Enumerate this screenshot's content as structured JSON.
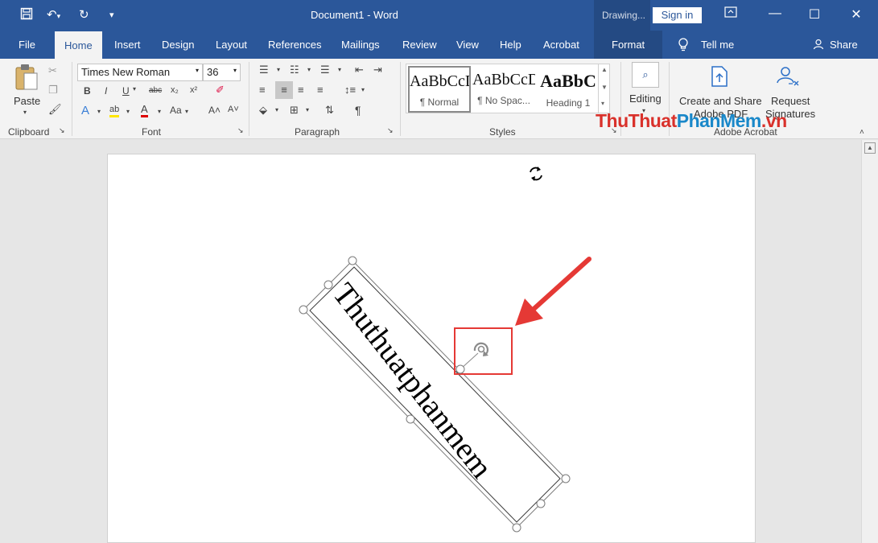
{
  "titlebar": {
    "title": "Document1  -  Word",
    "drawing_label": "Drawing...",
    "sign_in": "Sign in"
  },
  "tabs": [
    "File",
    "Home",
    "Insert",
    "Design",
    "Layout",
    "References",
    "Mailings",
    "Review",
    "View",
    "Help",
    "Acrobat",
    "Format"
  ],
  "tell_me": "Tell me",
  "share": "Share",
  "ribbon": {
    "paste": "Paste",
    "clipboard": "Clipboard",
    "font_name": "Times New Roman",
    "font_size": "36",
    "font_group": "Font",
    "paragraph_group": "Paragraph",
    "styles_group": "Styles",
    "styles": [
      {
        "sample": "AaBbCcDc",
        "name": "¶ Normal"
      },
      {
        "sample": "AaBbCcDc",
        "name": "¶ No Spac..."
      },
      {
        "sample": "AaBbC",
        "name": "Heading 1"
      }
    ],
    "editing": "Editing",
    "create_share_1": "Create and Share",
    "create_share_2": "Adobe PDF",
    "request_1": "Request",
    "request_2": "Signatures",
    "adobe_group": "Adobe Acrobat"
  },
  "watermark": {
    "a": "ThuThuat",
    "b": "PhanMem",
    "c": ".vn"
  },
  "document": {
    "textbox_text": "Thuthuatphanmem",
    "textbox_angle_deg": 52
  },
  "colors": {
    "word_blue": "#2b579a",
    "highlight_red": "#e53935"
  }
}
